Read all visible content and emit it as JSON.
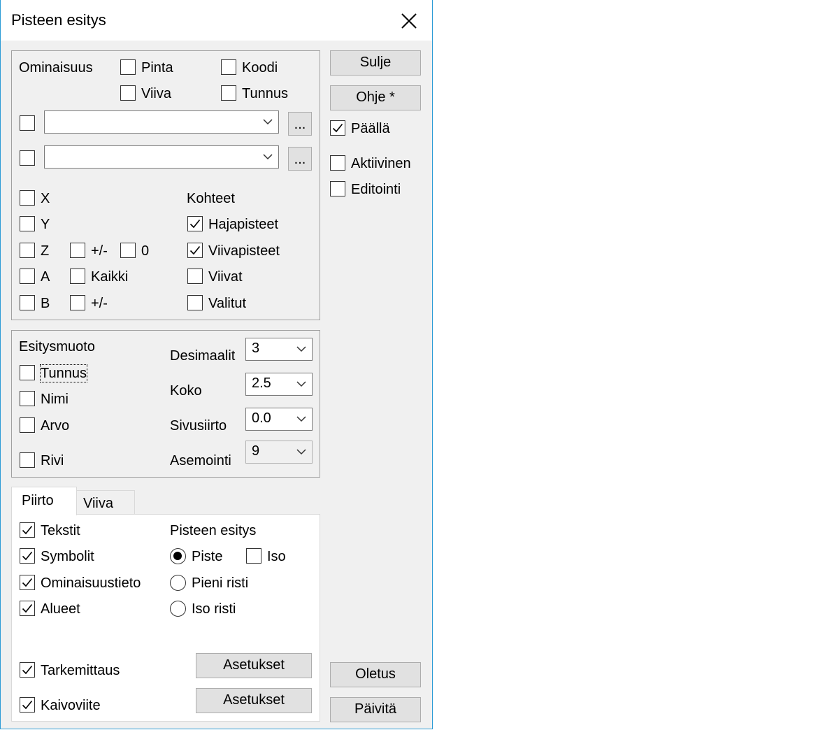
{
  "window": {
    "title": "Pisteen esitys"
  },
  "ominaisuus": {
    "label": "Ominaisuus",
    "pinta": {
      "label": "Pinta",
      "checked": false
    },
    "koodi": {
      "label": "Koodi",
      "checked": false
    },
    "viiva": {
      "label": "Viiva",
      "checked": false
    },
    "tunnus": {
      "label": "Tunnus",
      "checked": false
    },
    "combo1": {
      "value": "",
      "browse": "..."
    },
    "combo2": {
      "value": "",
      "browse": "..."
    }
  },
  "coords": {
    "x": "X",
    "y": "Y",
    "z": "Z",
    "z_pm": "+/-",
    "z_zero": "0",
    "a": "A",
    "a_kaikki": "Kaikki",
    "b": "B",
    "b_pm": "+/-"
  },
  "kohteet": {
    "label": "Kohteet",
    "hajapisteet": {
      "label": "Hajapisteet",
      "checked": true
    },
    "viivapisteet": {
      "label": "Viivapisteet",
      "checked": true
    },
    "viivat": {
      "label": "Viivat",
      "checked": false
    },
    "valitut": {
      "label": "Valitut",
      "checked": false
    }
  },
  "esitysmuoto": {
    "label": "Esitysmuoto",
    "tunnus": "Tunnus",
    "nimi": "Nimi",
    "arvo": "Arvo",
    "rivi": "Rivi",
    "desimaalit": {
      "label": "Desimaalit",
      "value": "3"
    },
    "koko": {
      "label": "Koko",
      "value": "2.5"
    },
    "sivusiirto": {
      "label": "Sivusiirto",
      "value": "0.0"
    },
    "asemointi": {
      "label": "Asemointi",
      "value": "9"
    }
  },
  "tabs": {
    "piirto": "Piirto",
    "viiva": "Viiva",
    "active": "Piirto"
  },
  "piirto": {
    "tekstit": {
      "label": "Tekstit",
      "checked": true
    },
    "symbolit": {
      "label": "Symbolit",
      "checked": true
    },
    "ominaisuustieto": {
      "label": "Ominaisuustieto",
      "checked": true
    },
    "alueet": {
      "label": "Alueet",
      "checked": true
    },
    "tarkemittaus": {
      "label": "Tarkemittaus",
      "checked": true
    },
    "kaivoviite": {
      "label": "Kaivoviite",
      "checked": true
    },
    "pisteen_esitys": "Pisteen esitys",
    "piste": {
      "label": "Piste",
      "selected": true
    },
    "iso": {
      "label": "Iso",
      "checked": false
    },
    "pieni_risti": {
      "label": "Pieni risti",
      "selected": false
    },
    "iso_risti": {
      "label": "Iso risti",
      "selected": false
    },
    "asetukset1": "Asetukset",
    "asetukset2": "Asetukset"
  },
  "side": {
    "sulje": "Sulje",
    "ohje": "Ohje *",
    "paalla": {
      "label": "Päällä",
      "checked": true
    },
    "aktiivinen": {
      "label": "Aktiivinen",
      "checked": false
    },
    "editointi": {
      "label": "Editointi",
      "checked": false
    },
    "oletus": "Oletus",
    "paivita": "Päivitä"
  },
  "icons": {
    "close": "close-icon",
    "check": "checkmark-icon",
    "dropdown": "chevron-down-icon",
    "radio": "radio-dot-icon"
  }
}
